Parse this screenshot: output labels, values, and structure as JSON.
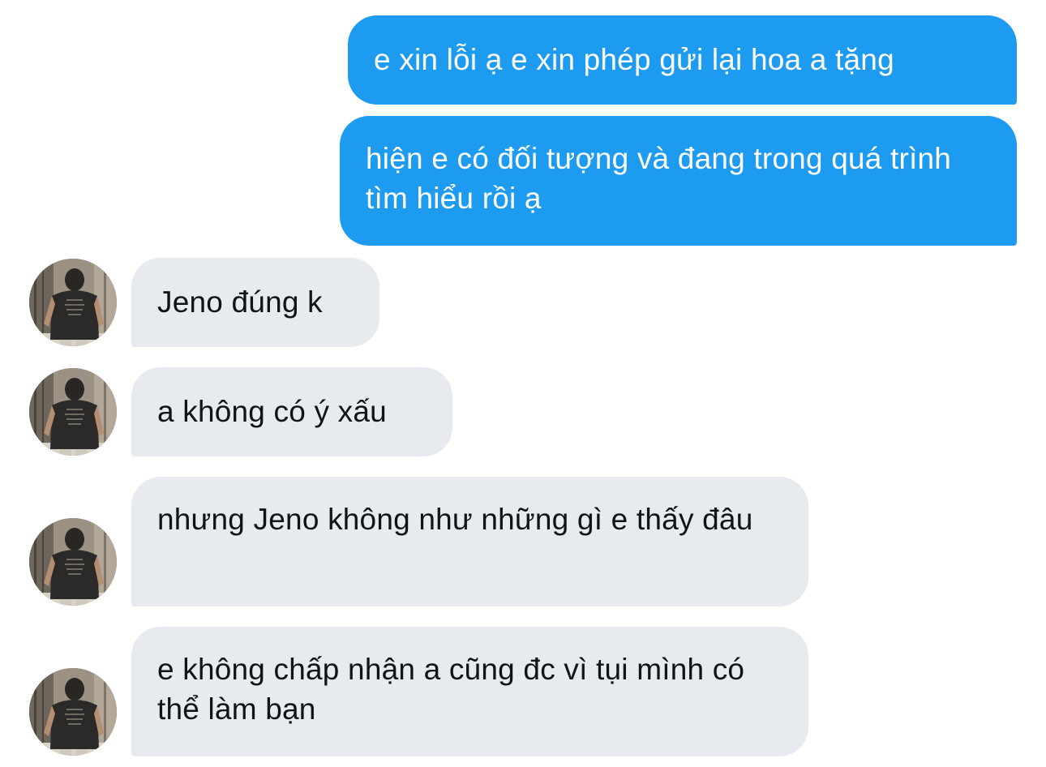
{
  "conversation": {
    "messages": [
      {
        "sender": "me",
        "text": "e xin lỗi ạ e xin phép gửi lại hoa a tặng"
      },
      {
        "sender": "me",
        "text": "hiện e có đối tượng và đang trong quá trình tìm hiểu rồi ạ"
      },
      {
        "sender": "other",
        "text": "Jeno đúng k"
      },
      {
        "sender": "other",
        "text": "a không có ý xấu"
      },
      {
        "sender": "other",
        "text": "nhưng Jeno không như những gì e thấy đâu"
      },
      {
        "sender": "other",
        "text": "e không chấp nhận a cũng đc vì tụi mình có thể làm bạn"
      }
    ]
  },
  "colors": {
    "sent_bubble": "#1d9bf0",
    "sent_text": "#ffffff",
    "received_bubble": "#e7ebef",
    "received_text": "#0f1419",
    "background": "#ffffff"
  },
  "icons": {
    "avatar": "contact-avatar-photo"
  }
}
